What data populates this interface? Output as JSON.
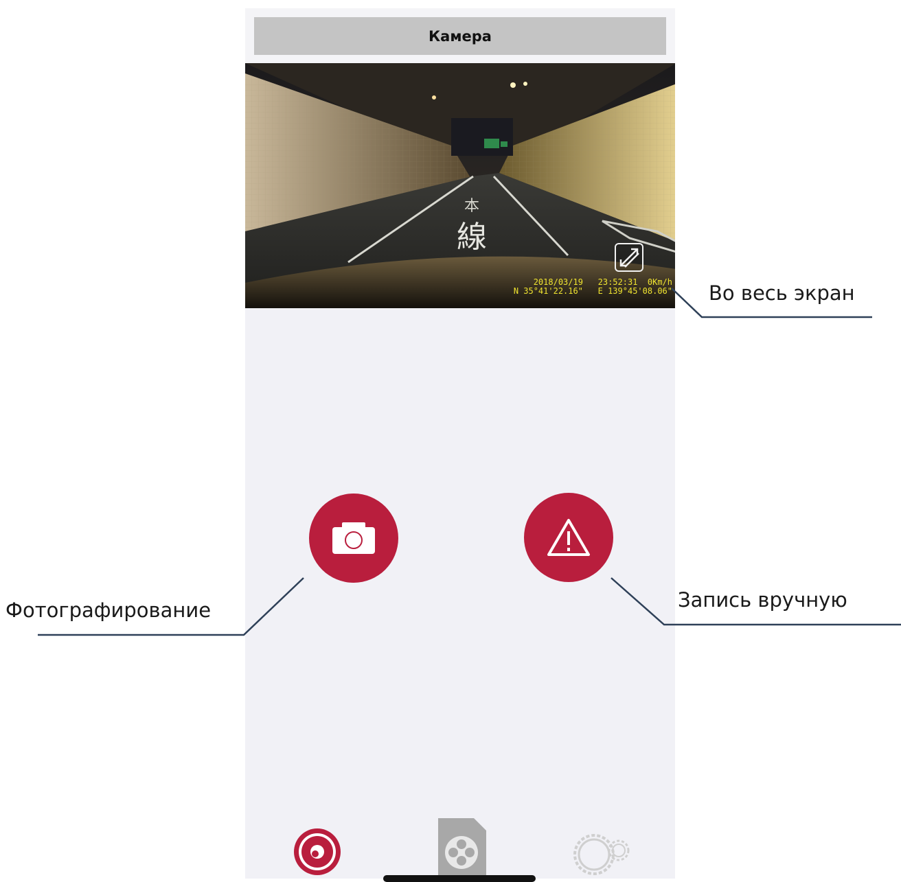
{
  "header": {
    "title": "Камера"
  },
  "video": {
    "osd_line1": "2018/03/19   23:52:31  0Km/h",
    "osd_line2": "N 35°41'22.16\"   E 139°45'08.06\"",
    "road_marking_top": "本",
    "road_marking_bottom": "線"
  },
  "actions": {
    "photo_icon": "camera-icon",
    "alarm_icon": "warning-triangle-icon"
  },
  "tabbar": {
    "items": [
      {
        "icon": "live-camera-icon",
        "active": true
      },
      {
        "icon": "film-reel-file-icon",
        "active": false
      },
      {
        "icon": "gear-icon",
        "active": false
      }
    ]
  },
  "annotations": {
    "fullscreen": "Во весь экран",
    "photo": "Фотографирование",
    "manual_record": "Запись вручную"
  },
  "colors": {
    "accent": "#b91e3d",
    "osd_text": "#f0e430",
    "title_bar": "#c4c4c4",
    "background": "#f1f1f6",
    "callout_line": "#2e4058"
  }
}
